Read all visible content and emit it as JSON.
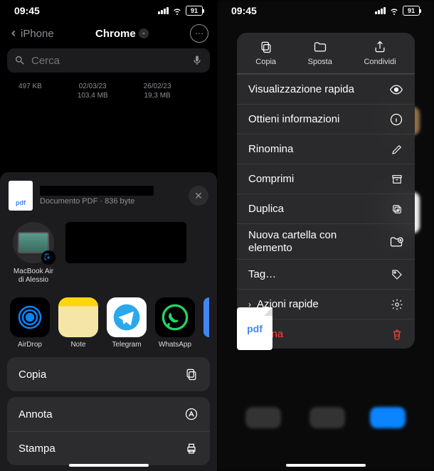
{
  "status": {
    "time": "09:45",
    "battery": "91"
  },
  "left": {
    "back": "iPhone",
    "title": "Chrome",
    "search_placeholder": "Cerca",
    "files": [
      {
        "size": "497 KB"
      },
      {
        "date": "02/03/23",
        "size": "103,4 MB"
      },
      {
        "date": "26/02/23",
        "size": "19,3 MB"
      }
    ],
    "share": {
      "doc_type": "pdf",
      "doc_info": "Documento PDF · 836 byte",
      "device_name": "MacBook Air di Alessio",
      "apps": {
        "airdrop": "AirDrop",
        "note": "Note",
        "telegram": "Telegram",
        "whatsapp": "WhatsApp"
      },
      "actions": {
        "copy": "Copia",
        "annotate": "Annota",
        "print": "Stampa"
      }
    }
  },
  "right": {
    "top": {
      "copy": "Copia",
      "move": "Sposta",
      "share": "Condividi"
    },
    "rows": {
      "quicklook": "Visualizzazione rapida",
      "info": "Ottieni informazioni",
      "rename": "Rinomina",
      "compress": "Comprimi",
      "duplicate": "Duplica",
      "newfolder": "Nuova cartella con elemento",
      "tags": "Tag…",
      "quickactions": "Azioni rapide",
      "delete": "Elimina"
    },
    "file_label": "pdf"
  }
}
